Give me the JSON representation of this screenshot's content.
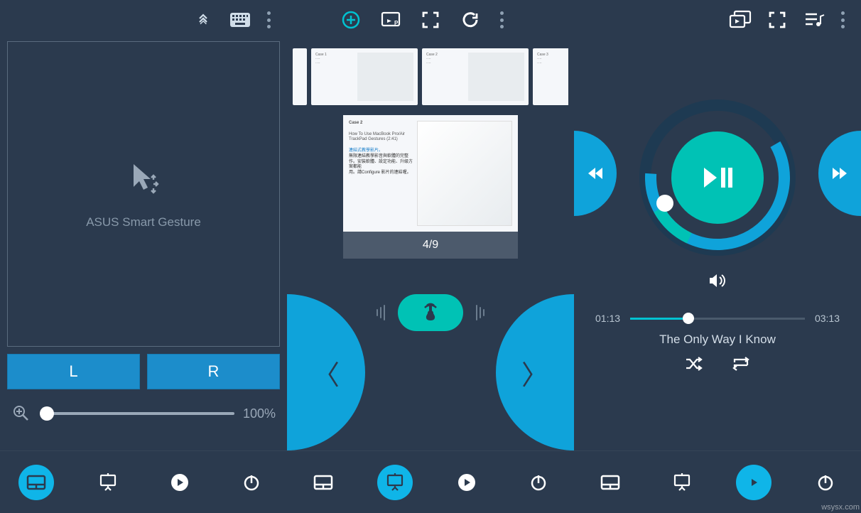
{
  "panel1": {
    "trackpad_label": "ASUS Smart Gesture",
    "left_btn": "L",
    "right_btn": "R",
    "zoom_value": "100%"
  },
  "panel2": {
    "slide_title": "Case 2",
    "slide_subtitle": "How To Use MacBook Pro/Air TrackPad Gestures (2:41)",
    "slide_counter": "4/9",
    "thumb_count": 3
  },
  "panel3": {
    "current_time": "01:13",
    "duration": "03:13",
    "track_title": "The Only Way I Know"
  },
  "nav": {
    "items": [
      "trackpad",
      "present",
      "media",
      "power"
    ]
  },
  "watermark": "wsysx.com",
  "icons": {
    "collapse": "collapse",
    "keyboard": "keyboard",
    "add": "add",
    "cast": "cast",
    "fullscreen": "fullscreen",
    "refresh": "refresh",
    "display": "display",
    "playlist": "playlist"
  }
}
